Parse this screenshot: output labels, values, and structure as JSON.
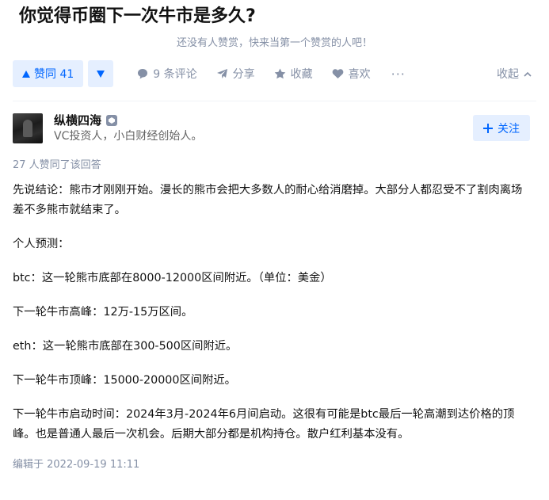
{
  "question": {
    "title": "你觉得币圈下一次牛市是多久?"
  },
  "reward_tip": "还没有人赞赏，快来当第一个赞赏的人吧！",
  "actions": {
    "vote_up_label": "赞同 41",
    "comments_label": "9 条评论",
    "share_label": "分享",
    "favorite_label": "收藏",
    "like_label": "喜欢",
    "more_label": "···",
    "collapse_label": "收起"
  },
  "author": {
    "name": "纵横四海",
    "bio": "VC投资人，小白财经创始人。",
    "follow_label": "关注"
  },
  "voters_text": "27 人赞同了该回答",
  "answer": {
    "paragraphs": [
      "先说结论：熊市才刚刚开始。漫长的熊市会把大多数人的耐心给消磨掉。大部分人都忍受不了割肉离场差不多熊市就结束了。",
      "个人预测：",
      "btc：这一轮熊市底部在8000-12000区间附近。（单位：美金）",
      "下一轮牛市高峰：12万-15万区间。",
      "eth：这一轮熊市底部在300-500区间附近。",
      "下一轮牛市顶峰：15000-20000区间附近。",
      "下一轮牛市启动时间：2024年3月-2024年6月间启动。这很有可能是btc最后一轮高潮到达价格的顶峰。也是普通人最后一次机会。后期大部分都是机构持仓。散户红利基本没有。"
    ],
    "edited_text": "编辑于 2022-09-19 11:11"
  },
  "colors": {
    "accent": "#0066ff",
    "accent_bg": "#e5efff",
    "muted": "#8590a6"
  },
  "icons": [
    "caret-up-icon",
    "caret-down-icon",
    "comment-icon",
    "share-icon",
    "star-icon",
    "heart-icon",
    "chevron-up-icon",
    "plus-icon",
    "badge-icon"
  ]
}
